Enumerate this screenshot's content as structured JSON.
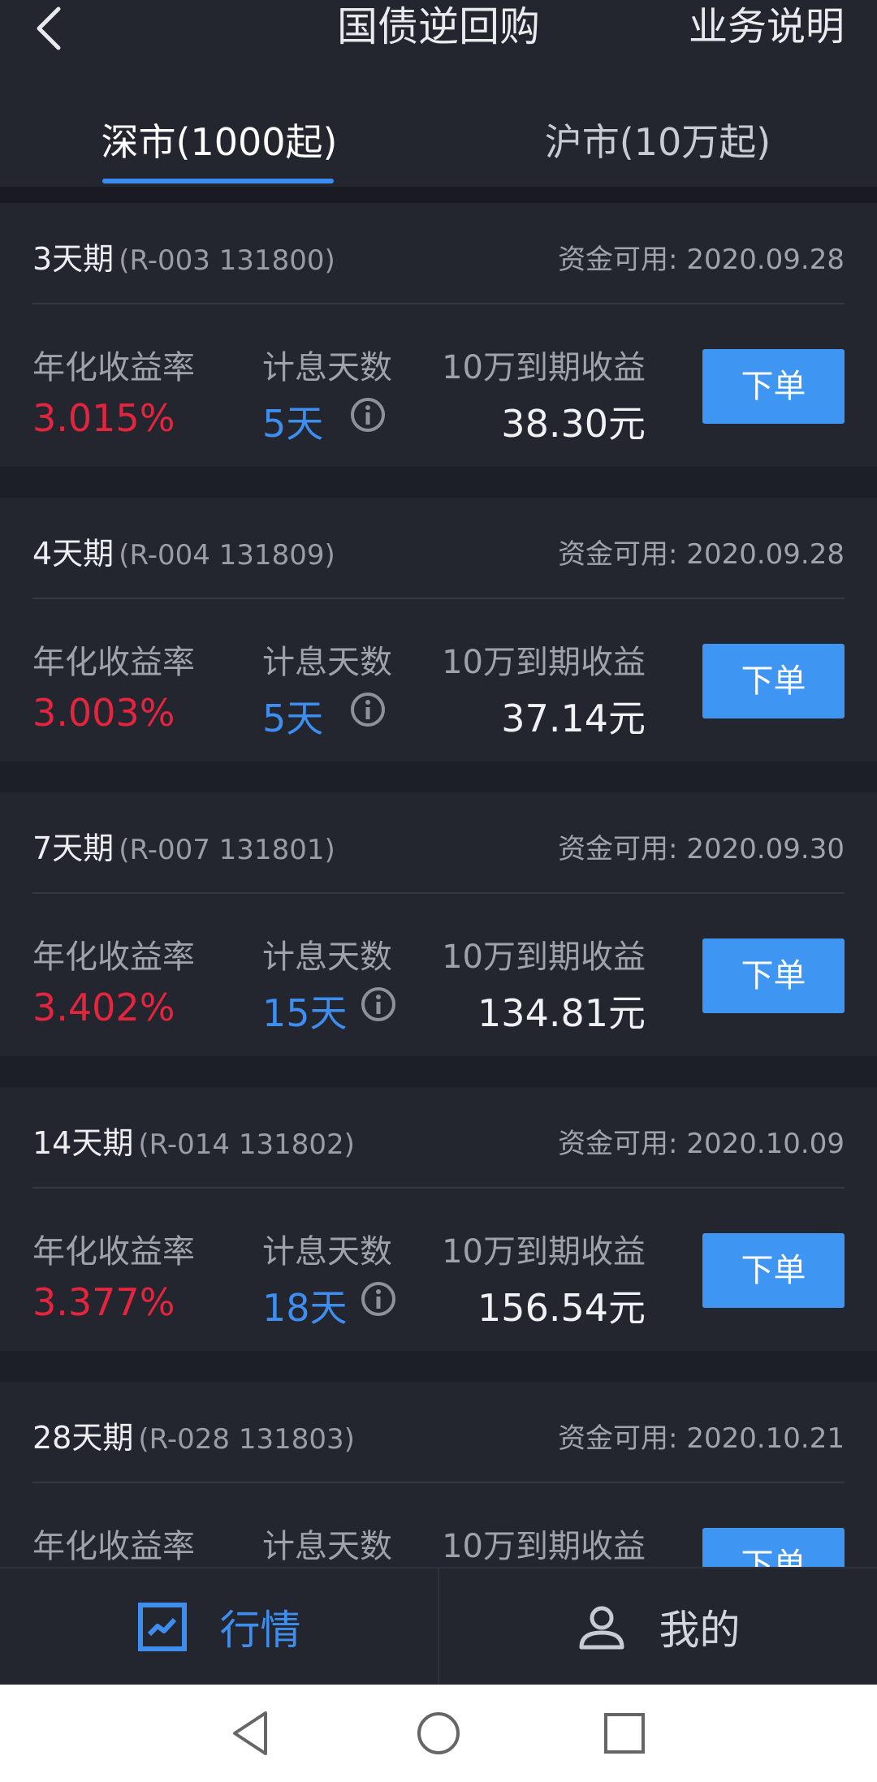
{
  "header": {
    "title": "国债逆回购",
    "help_label": "业务说明",
    "back_icon": "chevron-left-icon"
  },
  "tabs": [
    {
      "label": "深市(1000起)",
      "active": true
    },
    {
      "label": "沪市(10万起)",
      "active": false
    }
  ],
  "labels": {
    "rate": "年化收益率",
    "days": "计息天数",
    "gain": "10万到期收益",
    "order": "下单"
  },
  "items": [
    {
      "term": "3天期",
      "code": "(R-003 131800)",
      "avail": "资金可用: 2020.09.28",
      "rate": "3.015%",
      "days": "5天",
      "gain": "38.30元"
    },
    {
      "term": "4天期",
      "code": "(R-004 131809)",
      "avail": "资金可用: 2020.09.28",
      "rate": "3.003%",
      "days": "5天",
      "gain": "37.14元"
    },
    {
      "term": "7天期",
      "code": "(R-007 131801)",
      "avail": "资金可用: 2020.09.30",
      "rate": "3.402%",
      "days": "15天",
      "gain": "134.81元"
    },
    {
      "term": "14天期",
      "code": "(R-014 131802)",
      "avail": "资金可用: 2020.10.09",
      "rate": "3.377%",
      "days": "18天",
      "gain": "156.54元"
    },
    {
      "term": "28天期",
      "code": "(R-028 131803)",
      "avail": "资金可用: 2020.10.21",
      "rate": "",
      "days": "",
      "gain": ""
    }
  ],
  "bottom_nav": [
    {
      "label": "行情",
      "icon": "chart-icon",
      "active": true
    },
    {
      "label": "我的",
      "icon": "user-icon",
      "active": false
    }
  ],
  "colors": {
    "background": "#1d1f28",
    "card": "#23252f",
    "accent": "#3e8ef0",
    "rate_red": "#e3253e",
    "button_blue": "#3e95f2"
  }
}
